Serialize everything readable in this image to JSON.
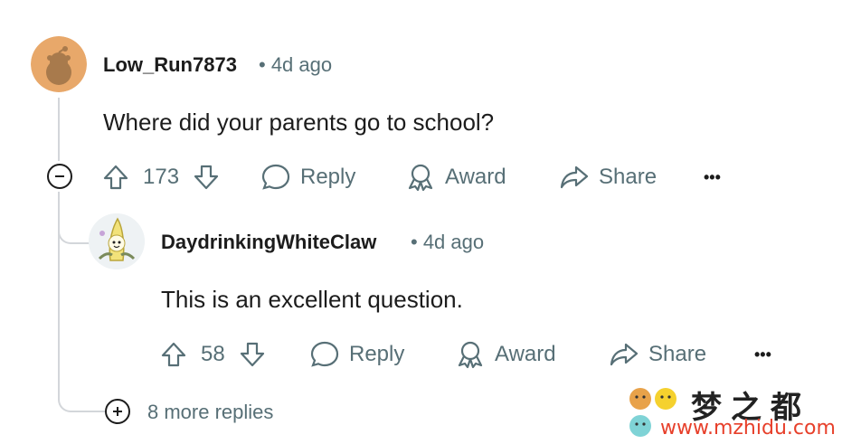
{
  "comments": [
    {
      "username": "Low_Run7873",
      "time": "• 4d ago",
      "body": "Where did your parents go to school?",
      "votes": "173",
      "actions": {
        "reply": "Reply",
        "award": "Award",
        "share": "Share",
        "more": "•••"
      }
    },
    {
      "username": "DaydrinkingWhiteClaw",
      "time": "• 4d ago",
      "body": "This is an excellent question.",
      "votes": "58",
      "actions": {
        "reply": "Reply",
        "award": "Award",
        "share": "Share",
        "more": "•••"
      }
    }
  ],
  "more_replies": "8 more replies",
  "watermark": {
    "top": "梦之都",
    "bottom": "www.mzhidu.com"
  },
  "colors": {
    "muted": "#576f76",
    "thread_line": "#d3d6da",
    "avatar_bg": "#e8a86a"
  }
}
